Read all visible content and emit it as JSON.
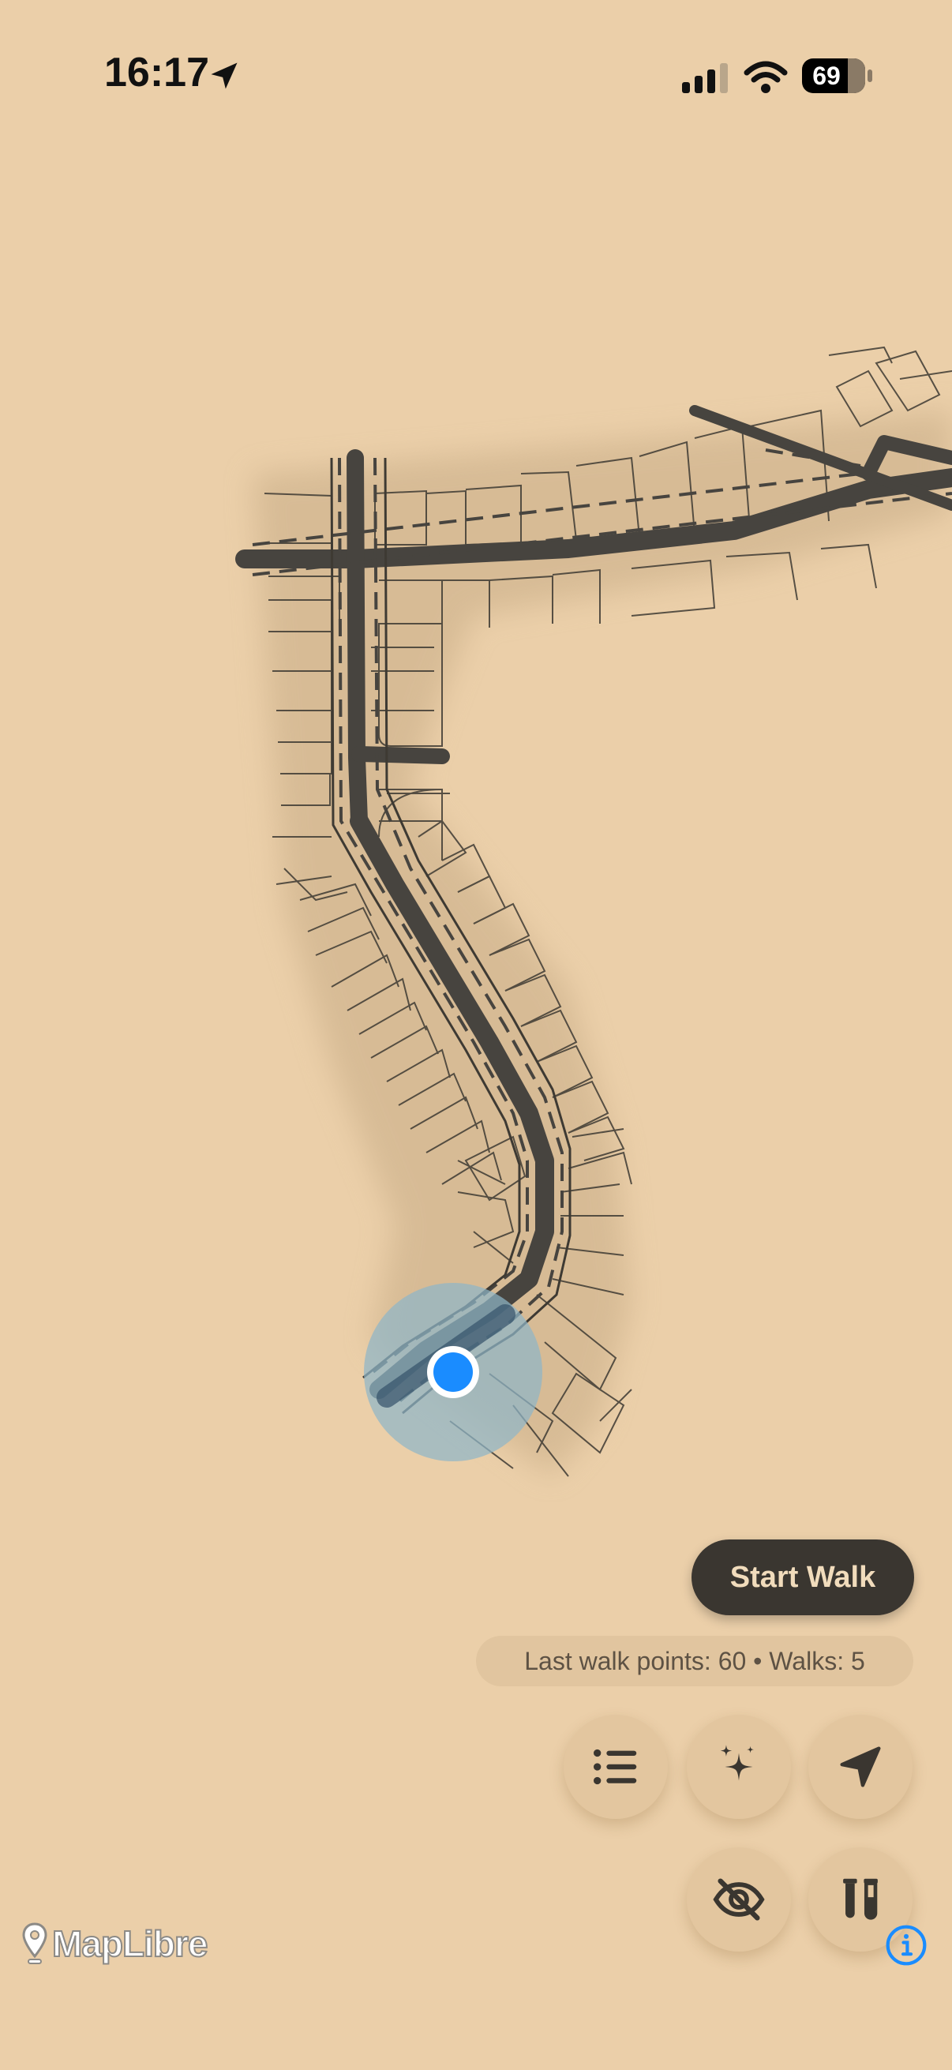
{
  "status_bar": {
    "time": "16:17",
    "battery": "69",
    "icons": [
      "location-arrow-icon",
      "cellular-signal-icon",
      "wifi-icon",
      "battery-icon"
    ]
  },
  "map": {
    "attribution": "MapLibre",
    "user_location_color": "#1a8cff",
    "accuracy_circle_color": "#8fb5c8",
    "road_color": "#47443f"
  },
  "controls": {
    "start_walk_label": "Start Walk",
    "stats_text": "Last walk points: 60 • Walks: 5",
    "buttons": [
      "list-icon",
      "sparkles-icon",
      "navigation-arrow-icon",
      "eye-slash-icon",
      "test-tubes-icon",
      "info-icon"
    ]
  },
  "colors": {
    "background": "#ebcfa9",
    "button_dark": "#3a3630",
    "button_text": "#f1dcbc",
    "fab_background": "#e3c69f"
  }
}
